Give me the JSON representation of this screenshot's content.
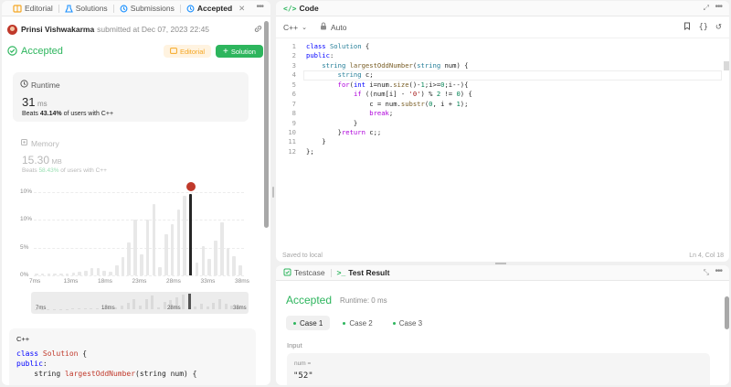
{
  "tabs": [
    {
      "label": "Editorial",
      "icon": "book-icon"
    },
    {
      "label": "Solutions",
      "icon": "flask-icon"
    },
    {
      "label": "Submissions",
      "icon": "history-icon"
    },
    {
      "label": "Accepted",
      "icon": "history-icon",
      "active": true
    }
  ],
  "submission": {
    "user": "Prinsi Vishwakarma",
    "meta": "submitted at Dec 07, 2023 22:45",
    "status": "Accepted",
    "editorial_btn": "Editorial",
    "solution_btn": "Solution"
  },
  "runtime": {
    "label": "Runtime",
    "value": "31",
    "unit": "ms",
    "beats_prefix": "Beats",
    "beats_pct": "43.14%",
    "beats_suffix": "of users with C++"
  },
  "memory": {
    "label": "Memory",
    "value": "15.30",
    "unit": "MB",
    "beats_prefix": "Beats",
    "beats_pct": "58.43%",
    "beats_suffix": "of users with C++"
  },
  "chart_data": {
    "type": "bar",
    "yticks": [
      "10%",
      "10%",
      "5%",
      "0%"
    ],
    "xticks": [
      "7ms",
      "13ms",
      "18ms",
      "23ms",
      "28ms",
      "33ms",
      "38ms"
    ],
    "mini_xticks": [
      "7ms",
      "18ms",
      "28ms",
      "38ms"
    ],
    "values": [
      0.2,
      0.2,
      0.2,
      0.2,
      0.3,
      0.3,
      0.4,
      0.5,
      0.7,
      1.0,
      1.0,
      0.7,
      0.5,
      1.5,
      2.6,
      4.7,
      8.0,
      3.0,
      8.0,
      10.3,
      1.2,
      6.0,
      7.4,
      9.5,
      11.5,
      11.8,
      1.8,
      4.2,
      2.4,
      5.0,
      7.6,
      4.0,
      2.8,
      1.5
    ],
    "highlight_index": 25,
    "ymax": 12
  },
  "code_preview": {
    "lang": "C++",
    "lines": [
      "class Solution {",
      "public:",
      "    string largestOddNumber(string num) {"
    ]
  },
  "editor": {
    "title": "Code",
    "language": "C++",
    "auto": "Auto",
    "saved": "Saved to local",
    "cursor": "Ln 4, Col 18",
    "lines": [
      [
        {
          "t": "class ",
          "c": "kw"
        },
        {
          "t": "Solution",
          "c": "ty"
        },
        {
          "t": " {",
          "c": ""
        }
      ],
      [
        {
          "t": "public",
          "c": "kw"
        },
        {
          "t": ":",
          "c": ""
        }
      ],
      [
        {
          "t": "    ",
          "c": ""
        },
        {
          "t": "string ",
          "c": "ty"
        },
        {
          "t": "largestOddNumber",
          "c": "fn"
        },
        {
          "t": "(",
          "c": ""
        },
        {
          "t": "string ",
          "c": "ty"
        },
        {
          "t": "num) {",
          "c": ""
        }
      ],
      [
        {
          "t": "        ",
          "c": ""
        },
        {
          "t": "string ",
          "c": "ty"
        },
        {
          "t": "c;",
          "c": ""
        }
      ],
      [
        {
          "t": "        ",
          "c": ""
        },
        {
          "t": "for",
          "c": "kc"
        },
        {
          "t": "(",
          "c": ""
        },
        {
          "t": "int ",
          "c": "kw"
        },
        {
          "t": "i=num.",
          "c": ""
        },
        {
          "t": "size",
          "c": "fn"
        },
        {
          "t": "()-",
          "c": ""
        },
        {
          "t": "1",
          "c": "nm"
        },
        {
          "t": ";i>=",
          "c": ""
        },
        {
          "t": "0",
          "c": "nm"
        },
        {
          "t": ";i--){",
          "c": ""
        }
      ],
      [
        {
          "t": "            ",
          "c": ""
        },
        {
          "t": "if",
          "c": "kc"
        },
        {
          "t": " ((num[i] - ",
          "c": ""
        },
        {
          "t": "'0'",
          "c": "st"
        },
        {
          "t": ") % ",
          "c": ""
        },
        {
          "t": "2",
          "c": "nm"
        },
        {
          "t": " != ",
          "c": ""
        },
        {
          "t": "0",
          "c": "nm"
        },
        {
          "t": ") {",
          "c": ""
        }
      ],
      [
        {
          "t": "                ",
          "c": ""
        },
        {
          "t": "c = num.",
          "c": ""
        },
        {
          "t": "substr",
          "c": "fn"
        },
        {
          "t": "(",
          "c": ""
        },
        {
          "t": "0",
          "c": "nm"
        },
        {
          "t": ", i + ",
          "c": ""
        },
        {
          "t": "1",
          "c": "nm"
        },
        {
          "t": ");",
          "c": ""
        }
      ],
      [
        {
          "t": "                ",
          "c": ""
        },
        {
          "t": "break",
          "c": "kc"
        },
        {
          "t": ";",
          "c": ""
        }
      ],
      [
        {
          "t": "            }",
          "c": ""
        }
      ],
      [
        {
          "t": "        }",
          "c": ""
        },
        {
          "t": "return ",
          "c": "kc"
        },
        {
          "t": "c;;",
          "c": ""
        }
      ],
      [
        {
          "t": "    }",
          "c": ""
        }
      ],
      [
        {
          "t": "};",
          "c": ""
        }
      ]
    ]
  },
  "result": {
    "tab_testcase": "Testcase",
    "tab_result": "Test Result",
    "status": "Accepted",
    "runtime": "Runtime: 0 ms",
    "cases": [
      "Case 1",
      "Case 2",
      "Case 3"
    ],
    "input_label": "Input",
    "param_name": "num =",
    "param_value": "\"52\""
  }
}
